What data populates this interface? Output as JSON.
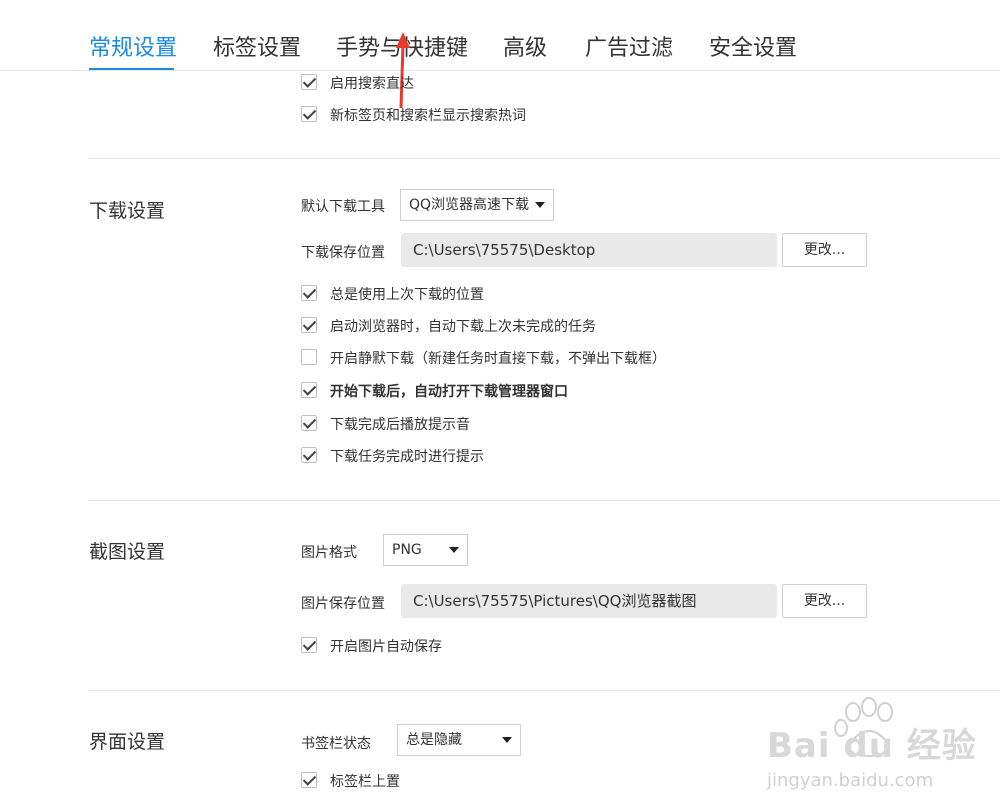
{
  "tabs": [
    "常规设置",
    "标签设置",
    "手势与快捷键",
    "高级",
    "广告过滤",
    "安全设置"
  ],
  "top_options": [
    {
      "label": "启用搜索直达",
      "checked": true
    },
    {
      "label": "新标签页和搜索栏显示搜索热词",
      "checked": true
    }
  ],
  "download": {
    "title": "下载设置",
    "tool_label": "默认下载工具",
    "tool_value": "QQ浏览器高速下载",
    "path_label": "下载保存位置",
    "path_value": "C:\\Users\\75575\\Desktop",
    "change_label": "更改...",
    "options": [
      {
        "label": "总是使用上次下载的位置",
        "checked": true
      },
      {
        "label": "启动浏览器时，自动下载上次未完成的任务",
        "checked": true
      },
      {
        "label": "开启静默下载（新建任务时直接下载，不弹出下载框）",
        "checked": false
      },
      {
        "label": "开始下载后，自动打开下载管理器窗口",
        "checked": true
      },
      {
        "label": "下载完成后播放提示音",
        "checked": true
      },
      {
        "label": "下载任务完成时进行提示",
        "checked": true
      }
    ]
  },
  "screenshot": {
    "title": "截图设置",
    "format_label": "图片格式",
    "format_value": "PNG",
    "path_label": "图片保存位置",
    "path_value": "C:\\Users\\75575\\Pictures\\QQ浏览器截图",
    "change_label": "更改...",
    "options": [
      {
        "label": "开启图片自动保存",
        "checked": true
      }
    ]
  },
  "interface": {
    "title": "界面设置",
    "bookmark_label": "书签栏状态",
    "bookmark_value": "总是隐藏",
    "options": [
      {
        "label": "标签栏上置",
        "checked": true
      }
    ]
  },
  "watermark": {
    "brand": "Bai du 经验",
    "url": "jingyan.baidu.com"
  },
  "colors": {
    "accent": "#1a8ae5",
    "arrow": "#e8392e"
  }
}
